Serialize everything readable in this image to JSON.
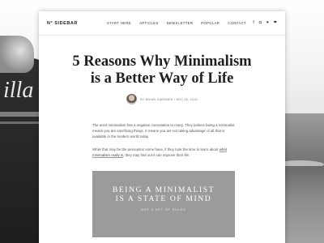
{
  "background": {
    "shirt_text": "illa"
  },
  "nav": {
    "logo": "N° SIDEBAR",
    "links": [
      "START HERE",
      "ARTICLES",
      "NEWSLETTER",
      "POPULAR",
      "CONTACT"
    ],
    "social_icons": [
      "facebook-icon",
      "instagram-icon",
      "twitter-icon",
      "heart-icon"
    ]
  },
  "article": {
    "title_line1": "5 Reasons Why Minimalism",
    "title_line2": "is a Better Way of Life",
    "byline": "BY BRIAN GARDNER / DEC 28, 2015",
    "para1": "The word minimalism has a negative connotation to many. They believe being a minimalist means you are sacrificing things. It means you are not taking advantage of all that is available in the modern world today.",
    "para2_before": "While that may be the perception some have, if they took the time to learn about ",
    "para2_link": "what minimalism really is",
    "para2_after": ", they may find out it can improve their life."
  },
  "quote": {
    "line1": "BEING A MINIMALIST",
    "line2": "IS A STATE OF MIND",
    "sub": "NOT A SET OF RULES"
  },
  "colors": {
    "quote_bg": "#9b9b9b",
    "card_bg": "#ffffff"
  }
}
